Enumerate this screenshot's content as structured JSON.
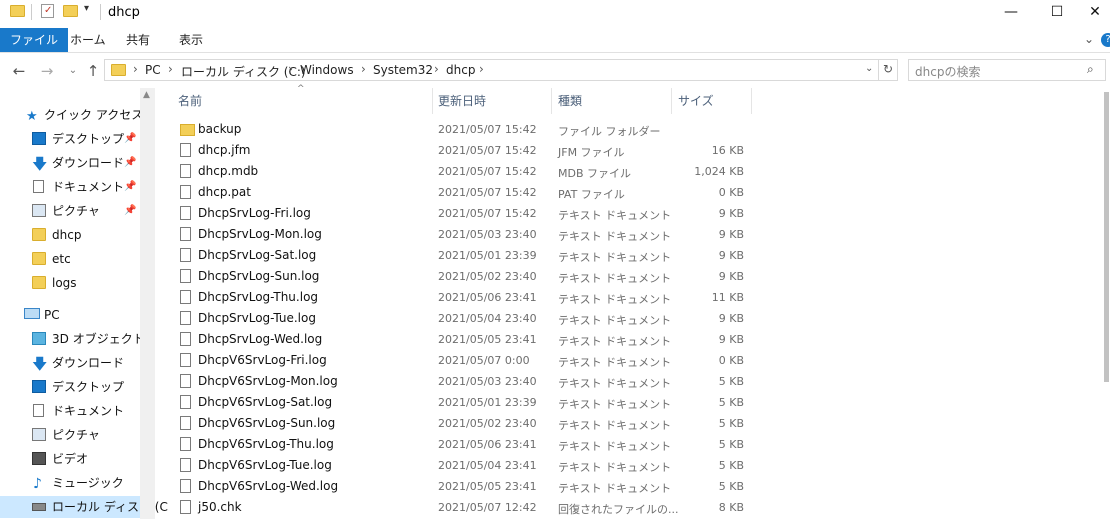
{
  "window": {
    "title": "dhcp",
    "controls": {
      "minimize": "—",
      "maximize": "☐",
      "close": "✕"
    },
    "help": "?",
    "expand": "⌄"
  },
  "ribbon": {
    "tabs": [
      {
        "label": "ファイル",
        "active": true
      },
      {
        "label": "ホーム"
      },
      {
        "label": "共有"
      },
      {
        "label": "表示"
      }
    ]
  },
  "address": {
    "crumbs": [
      "PC",
      "ローカル ディスク (C:)",
      "Windows",
      "System32",
      "dhcp"
    ],
    "search_placeholder": "dhcpの検索"
  },
  "navpane": {
    "items": [
      {
        "label": "クイック アクセス",
        "icon": "star-icon"
      },
      {
        "label": "デスクトップ",
        "icon": "desktop-icon",
        "pinned": true
      },
      {
        "label": "ダウンロード",
        "icon": "download-icon",
        "pinned": true
      },
      {
        "label": "ドキュメント",
        "icon": "document-icon",
        "pinned": true
      },
      {
        "label": "ピクチャ",
        "icon": "picture-icon",
        "pinned": true
      },
      {
        "label": "dhcp",
        "icon": "folder-icon"
      },
      {
        "label": "etc",
        "icon": "folder-icon"
      },
      {
        "label": "logs",
        "icon": "folder-icon"
      },
      {
        "label": "PC",
        "icon": "pc-icon"
      },
      {
        "label": "3D オブジェクト",
        "icon": "cube-icon"
      },
      {
        "label": "ダウンロード",
        "icon": "download-icon"
      },
      {
        "label": "デスクトップ",
        "icon": "desktop-icon"
      },
      {
        "label": "ドキュメント",
        "icon": "document-icon"
      },
      {
        "label": "ピクチャ",
        "icon": "picture-icon"
      },
      {
        "label": "ビデオ",
        "icon": "video-icon"
      },
      {
        "label": "ミュージック",
        "icon": "music-icon"
      },
      {
        "label": "ローカル ディスク (C",
        "icon": "drive-icon"
      }
    ]
  },
  "columns": {
    "name": "名前",
    "date": "更新日時",
    "type": "種類",
    "size": "サイズ",
    "sort_indicator": "^"
  },
  "files": [
    {
      "name": "backup",
      "date": "2021/05/07 15:42",
      "type": "ファイル フォルダー",
      "size": ""
    },
    {
      "name": "dhcp.jfm",
      "date": "2021/05/07 15:42",
      "type": "JFM ファイル",
      "size": "16 KB"
    },
    {
      "name": "dhcp.mdb",
      "date": "2021/05/07 15:42",
      "type": "MDB ファイル",
      "size": "1,024 KB"
    },
    {
      "name": "dhcp.pat",
      "date": "2021/05/07 15:42",
      "type": "PAT ファイル",
      "size": "0 KB"
    },
    {
      "name": "DhcpSrvLog-Fri.log",
      "date": "2021/05/07 15:42",
      "type": "テキスト ドキュメント",
      "size": "9 KB"
    },
    {
      "name": "DhcpSrvLog-Mon.log",
      "date": "2021/05/03 23:40",
      "type": "テキスト ドキュメント",
      "size": "9 KB"
    },
    {
      "name": "DhcpSrvLog-Sat.log",
      "date": "2021/05/01 23:39",
      "type": "テキスト ドキュメント",
      "size": "9 KB"
    },
    {
      "name": "DhcpSrvLog-Sun.log",
      "date": "2021/05/02 23:40",
      "type": "テキスト ドキュメント",
      "size": "9 KB"
    },
    {
      "name": "DhcpSrvLog-Thu.log",
      "date": "2021/05/06 23:41",
      "type": "テキスト ドキュメント",
      "size": "11 KB"
    },
    {
      "name": "DhcpSrvLog-Tue.log",
      "date": "2021/05/04 23:40",
      "type": "テキスト ドキュメント",
      "size": "9 KB"
    },
    {
      "name": "DhcpSrvLog-Wed.log",
      "date": "2021/05/05 23:41",
      "type": "テキスト ドキュメント",
      "size": "9 KB"
    },
    {
      "name": "DhcpV6SrvLog-Fri.log",
      "date": "2021/05/07 0:00",
      "type": "テキスト ドキュメント",
      "size": "0 KB"
    },
    {
      "name": "DhcpV6SrvLog-Mon.log",
      "date": "2021/05/03 23:40",
      "type": "テキスト ドキュメント",
      "size": "5 KB"
    },
    {
      "name": "DhcpV6SrvLog-Sat.log",
      "date": "2021/05/01 23:39",
      "type": "テキスト ドキュメント",
      "size": "5 KB"
    },
    {
      "name": "DhcpV6SrvLog-Sun.log",
      "date": "2021/05/02 23:40",
      "type": "テキスト ドキュメント",
      "size": "5 KB"
    },
    {
      "name": "DhcpV6SrvLog-Thu.log",
      "date": "2021/05/06 23:41",
      "type": "テキスト ドキュメント",
      "size": "5 KB"
    },
    {
      "name": "DhcpV6SrvLog-Tue.log",
      "date": "2021/05/04 23:41",
      "type": "テキスト ドキュメント",
      "size": "5 KB"
    },
    {
      "name": "DhcpV6SrvLog-Wed.log",
      "date": "2021/05/05 23:41",
      "type": "テキスト ドキュメント",
      "size": "5 KB"
    },
    {
      "name": "j50.chk",
      "date": "2021/05/07 12:42",
      "type": "回復されたファイルの...",
      "size": "8 KB"
    }
  ],
  "colors": {
    "accent": "#1979ca",
    "folder": "#f3cf58",
    "selected_nav": "#cce8ff"
  }
}
